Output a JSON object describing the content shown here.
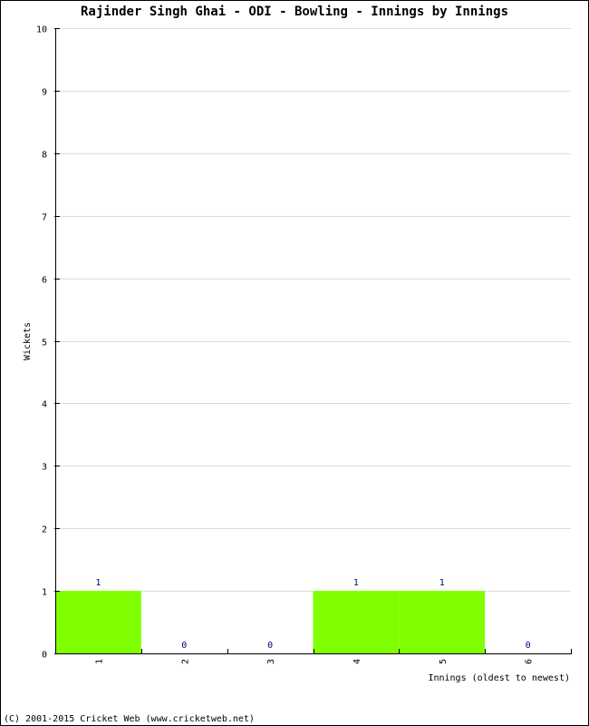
{
  "chart_data": {
    "type": "bar",
    "title": "Rajinder Singh Ghai - ODI - Bowling - Innings by Innings",
    "xlabel": "Innings (oldest to newest)",
    "ylabel": "Wickets",
    "categories": [
      "1",
      "2",
      "3",
      "4",
      "5",
      "6"
    ],
    "values": [
      1,
      0,
      0,
      1,
      1,
      0
    ],
    "data_labels": [
      "1",
      "0",
      "0",
      "1",
      "1",
      "0"
    ],
    "ylim": [
      0,
      10
    ],
    "yticks": [
      0,
      1,
      2,
      3,
      4,
      5,
      6,
      7,
      8,
      9,
      10
    ],
    "grid": true,
    "bar_color": "#80ff00",
    "label_color": "#000080",
    "grid_color": "#dddddd"
  },
  "footer": {
    "copyright": "(C) 2001-2015 Cricket Web (www.cricketweb.net)"
  }
}
